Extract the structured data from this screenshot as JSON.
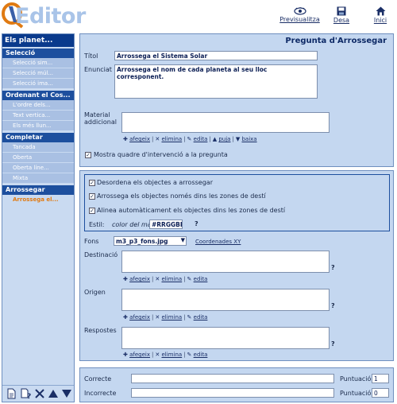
{
  "app": {
    "logo_text": "Editor",
    "actions": [
      {
        "label": "Previsualitza",
        "icon": "eye-icon"
      },
      {
        "label": "Desa",
        "icon": "save-icon"
      },
      {
        "label": "Inici",
        "icon": "home-icon"
      }
    ]
  },
  "sidebar": {
    "title": "Els planet...",
    "sections": [
      {
        "label": "Selecció",
        "items": [
          "Selecció sim...",
          "Selecció múl...",
          "Selecció ima..."
        ]
      },
      {
        "label": "Ordenant el Cos...",
        "items": [
          "L'ordre dels...",
          "Text vertica...",
          "Els més llun..."
        ]
      },
      {
        "label": "Completar",
        "items": [
          "Tancada",
          "Oberta",
          "Oberta líne...",
          "Mixta"
        ]
      },
      {
        "label": "Arrossegar",
        "items": [
          "Arrossega el..."
        ]
      }
    ],
    "active_item": "Arrossega el...",
    "toolbar": [
      "new-page-icon",
      "help-page-icon",
      "delete-icon",
      "move-up-icon",
      "move-down-icon"
    ]
  },
  "question": {
    "panel_title": "Pregunta d'Arrossegar",
    "title_label": "Títol",
    "title_value": "Arrossega el Sistema Solar",
    "statement_label": "Enunciat",
    "statement_value": "Arrossega el nom de cada planeta al seu lloc corresponent.",
    "material_label_1": "Material",
    "material_label_2": "addicional",
    "link_afegeix": "afegeix",
    "link_elimina": "elimina",
    "link_edita": "edita",
    "link_puja": "puja",
    "link_baixa": "baixa",
    "show_frame_label": "Mostra quadre d'intervenció a la pregunta",
    "show_frame_checked": true
  },
  "drag": {
    "shuffle_label": "Desordena els objectes a arrossegar",
    "shuffle_checked": true,
    "only_targets_label": "Arrossega els objectes només dins les zones de destí",
    "only_targets_checked": true,
    "autoalign_label": "Alinea automàticament els objectes dins les zones de destí",
    "autoalign_checked": true,
    "style_label": "Estil:",
    "frame_color_label": "color del marc",
    "frame_color_value": "#RRGGBB",
    "help_mark": "?",
    "background_label": "Fons",
    "background_value": "m3_p3_fons.jpg",
    "coords_link": "Coordenades XY",
    "destination_label": "Destinació",
    "origin_label": "Origen",
    "answers_label": "Respostes"
  },
  "feedback": {
    "correct_label": "Correcte",
    "incorrect_label": "Incorrecte",
    "score_label": "Puntuació:",
    "correct_score": "1",
    "incorrect_score": "0"
  }
}
